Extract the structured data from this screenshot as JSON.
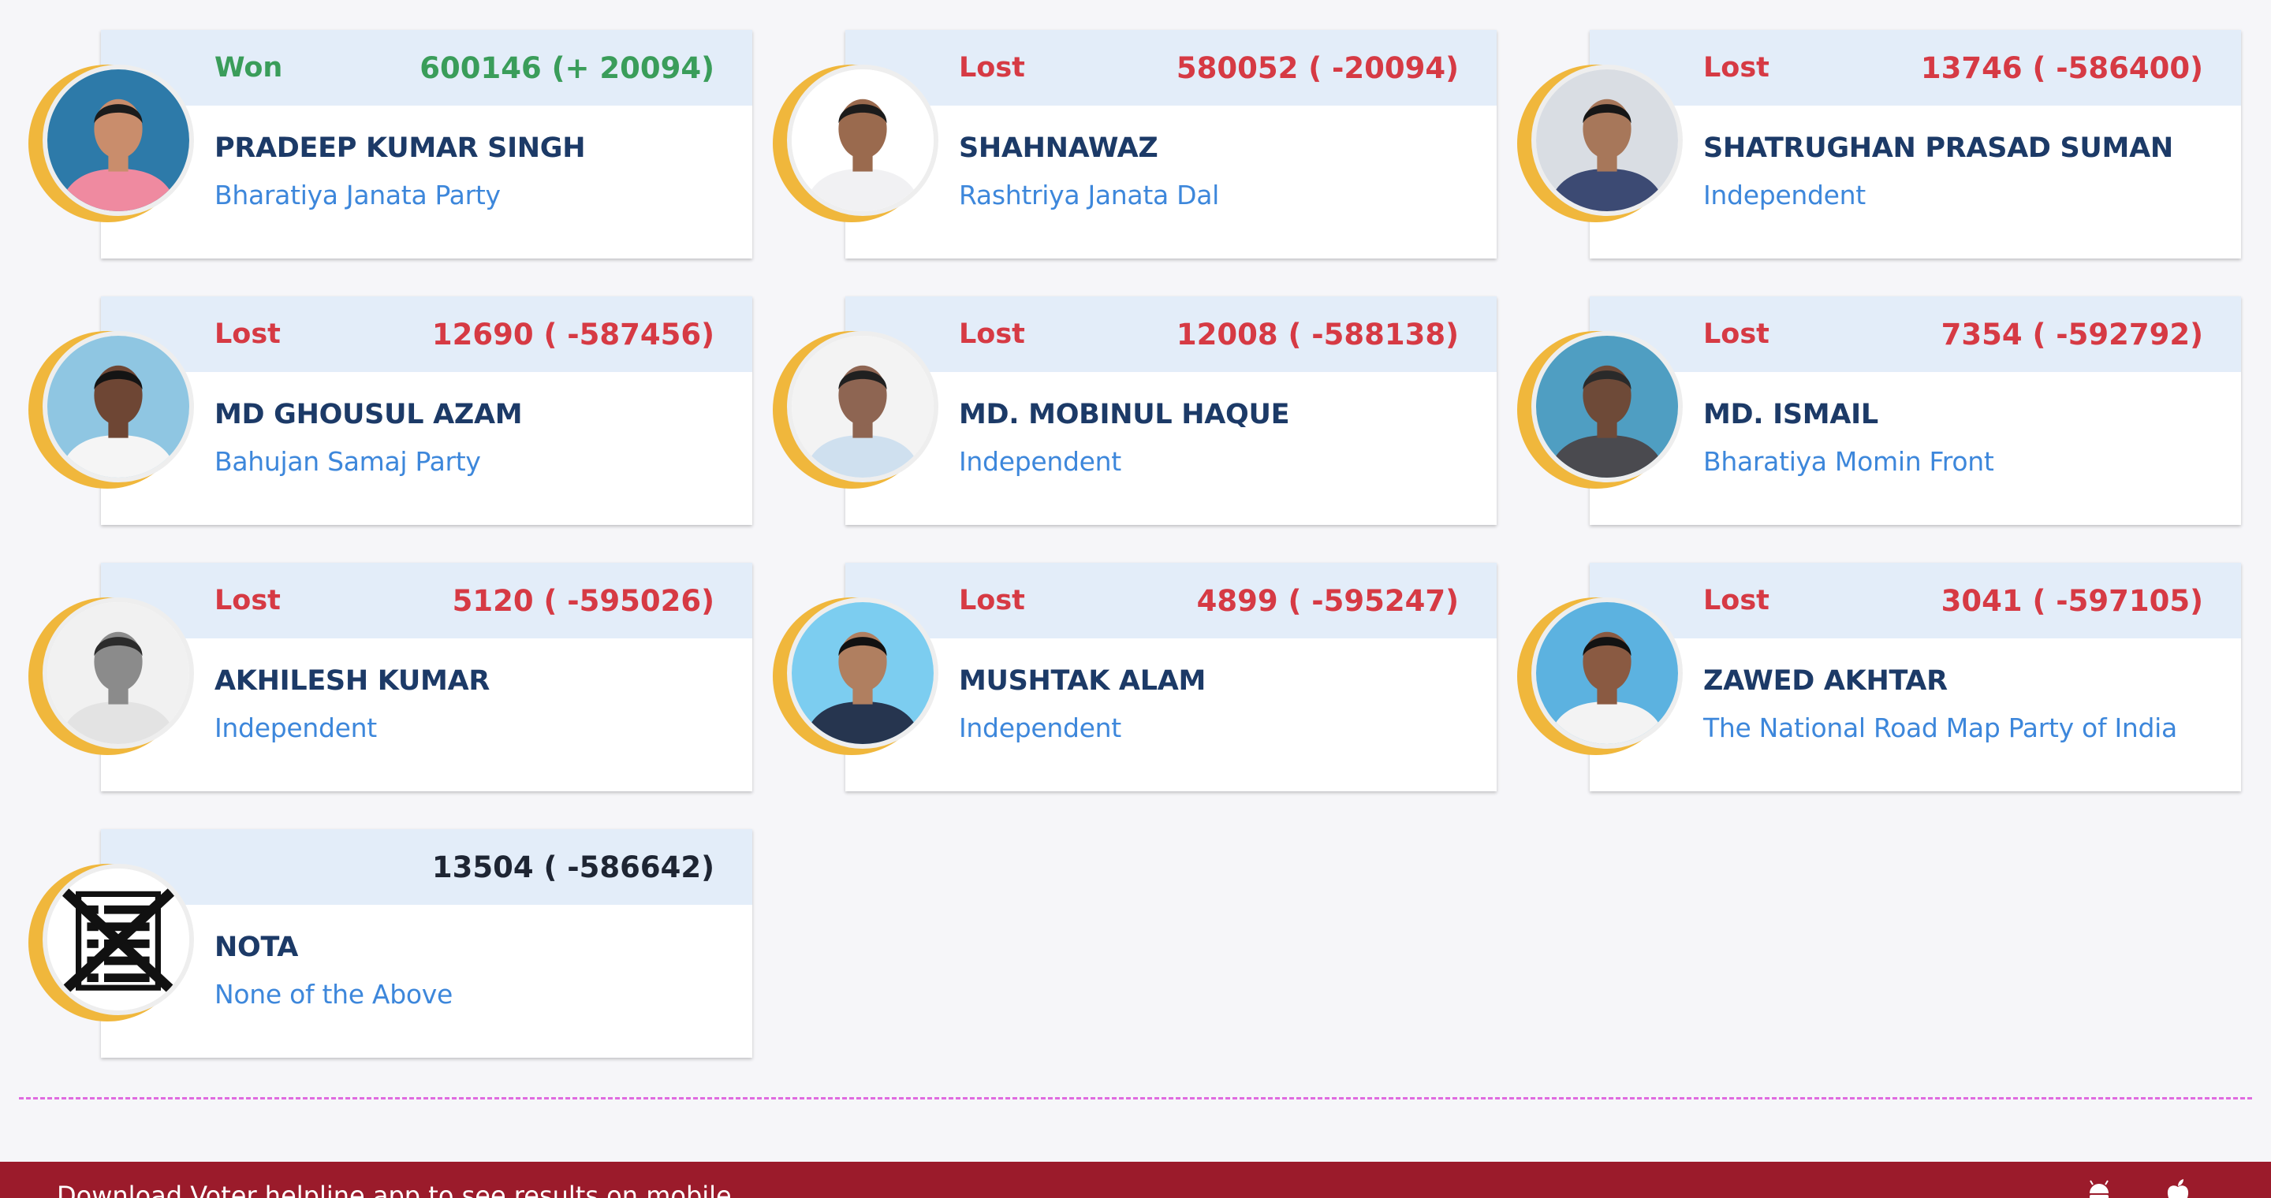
{
  "candidates": [
    {
      "status": "Won",
      "status_type": "won",
      "votes": "600146 (+ 20094)",
      "name": "PRADEEP KUMAR SINGH",
      "party": "Bharatiya Janata Party",
      "photo": {
        "bg": "#2d7aa9",
        "shirt": "#ef8aa0",
        "skin": "#c98d6c",
        "hair": "#1b1b1b"
      }
    },
    {
      "status": "Lost",
      "status_type": "lost",
      "votes": "580052 ( -20094)",
      "name": "SHAHNAWAZ",
      "party": "Rashtriya Janata Dal",
      "photo": {
        "bg": "#ffffff",
        "shirt": "#f1f1f3",
        "skin": "#9a6a4e",
        "hair": "#1b1b1b"
      }
    },
    {
      "status": "Lost",
      "status_type": "lost",
      "votes": "13746 ( -586400)",
      "name": "SHATRUGHAN PRASAD SUMAN",
      "party": "Independent",
      "photo": {
        "bg": "#d9dde3",
        "shirt": "#3c4a73",
        "skin": "#a7775a",
        "hair": "#161616"
      }
    },
    {
      "status": "Lost",
      "status_type": "lost",
      "votes": "12690 ( -587456)",
      "name": "MD GHOUSUL AZAM",
      "party": "Bahujan Samaj Party",
      "photo": {
        "bg": "#8fc6e2",
        "shirt": "#f5f5f5",
        "skin": "#6e4634",
        "hair": "#141414"
      }
    },
    {
      "status": "Lost",
      "status_type": "lost",
      "votes": "12008 ( -588138)",
      "name": "MD. MOBINUL HAQUE",
      "party": "Independent",
      "photo": {
        "bg": "#f3f3f3",
        "shirt": "#cfe0ef",
        "skin": "#8e6552",
        "hair": "#202020"
      }
    },
    {
      "status": "Lost",
      "status_type": "lost",
      "votes": "7354 ( -592792)",
      "name": "MD. ISMAIL",
      "party": "Bharatiya Momin Front",
      "photo": {
        "bg": "#4f9ec2",
        "shirt": "#4a4a4f",
        "skin": "#6e4a38",
        "hair": "#2a2a2a"
      }
    },
    {
      "status": "Lost",
      "status_type": "lost",
      "votes": "5120 ( -595026)",
      "name": "AKHILESH KUMAR",
      "party": "Independent",
      "photo": {
        "bg": "#f1f1f1",
        "shirt": "#e3e3e3",
        "skin": "#8b8b8b",
        "hair": "#2b2b2b"
      }
    },
    {
      "status": "Lost",
      "status_type": "lost",
      "votes": "4899 ( -595247)",
      "name": "MUSHTAK ALAM",
      "party": "Independent",
      "photo": {
        "bg": "#7ccdf0",
        "shirt": "#26354f",
        "skin": "#b07f60",
        "hair": "#111111"
      }
    },
    {
      "status": "Lost",
      "status_type": "lost",
      "votes": "3041 ( -597105)",
      "name": "ZAWED AKHTAR",
      "party": "The National Road Map Party of India",
      "photo": {
        "bg": "#5cb2e0",
        "shirt": "#f3f3f3",
        "skin": "#8a5a42",
        "hair": "#121212"
      }
    },
    {
      "status": "",
      "status_type": "neutral",
      "votes": "13504 ( -586642)",
      "name": "NOTA",
      "party": "None of the Above",
      "photo": null
    }
  ],
  "footer": {
    "text": "Download Voter helpline app to see results on mobile",
    "icons": [
      "android-icon",
      "apple-icon"
    ]
  },
  "colors": {
    "won": "#3a9d5a",
    "lost": "#d63a44",
    "name": "#1c3a67",
    "party": "#3d87db",
    "ring": "#f0b73c",
    "footer_bg": "#9b1b2b",
    "divider": "#e06be0"
  }
}
